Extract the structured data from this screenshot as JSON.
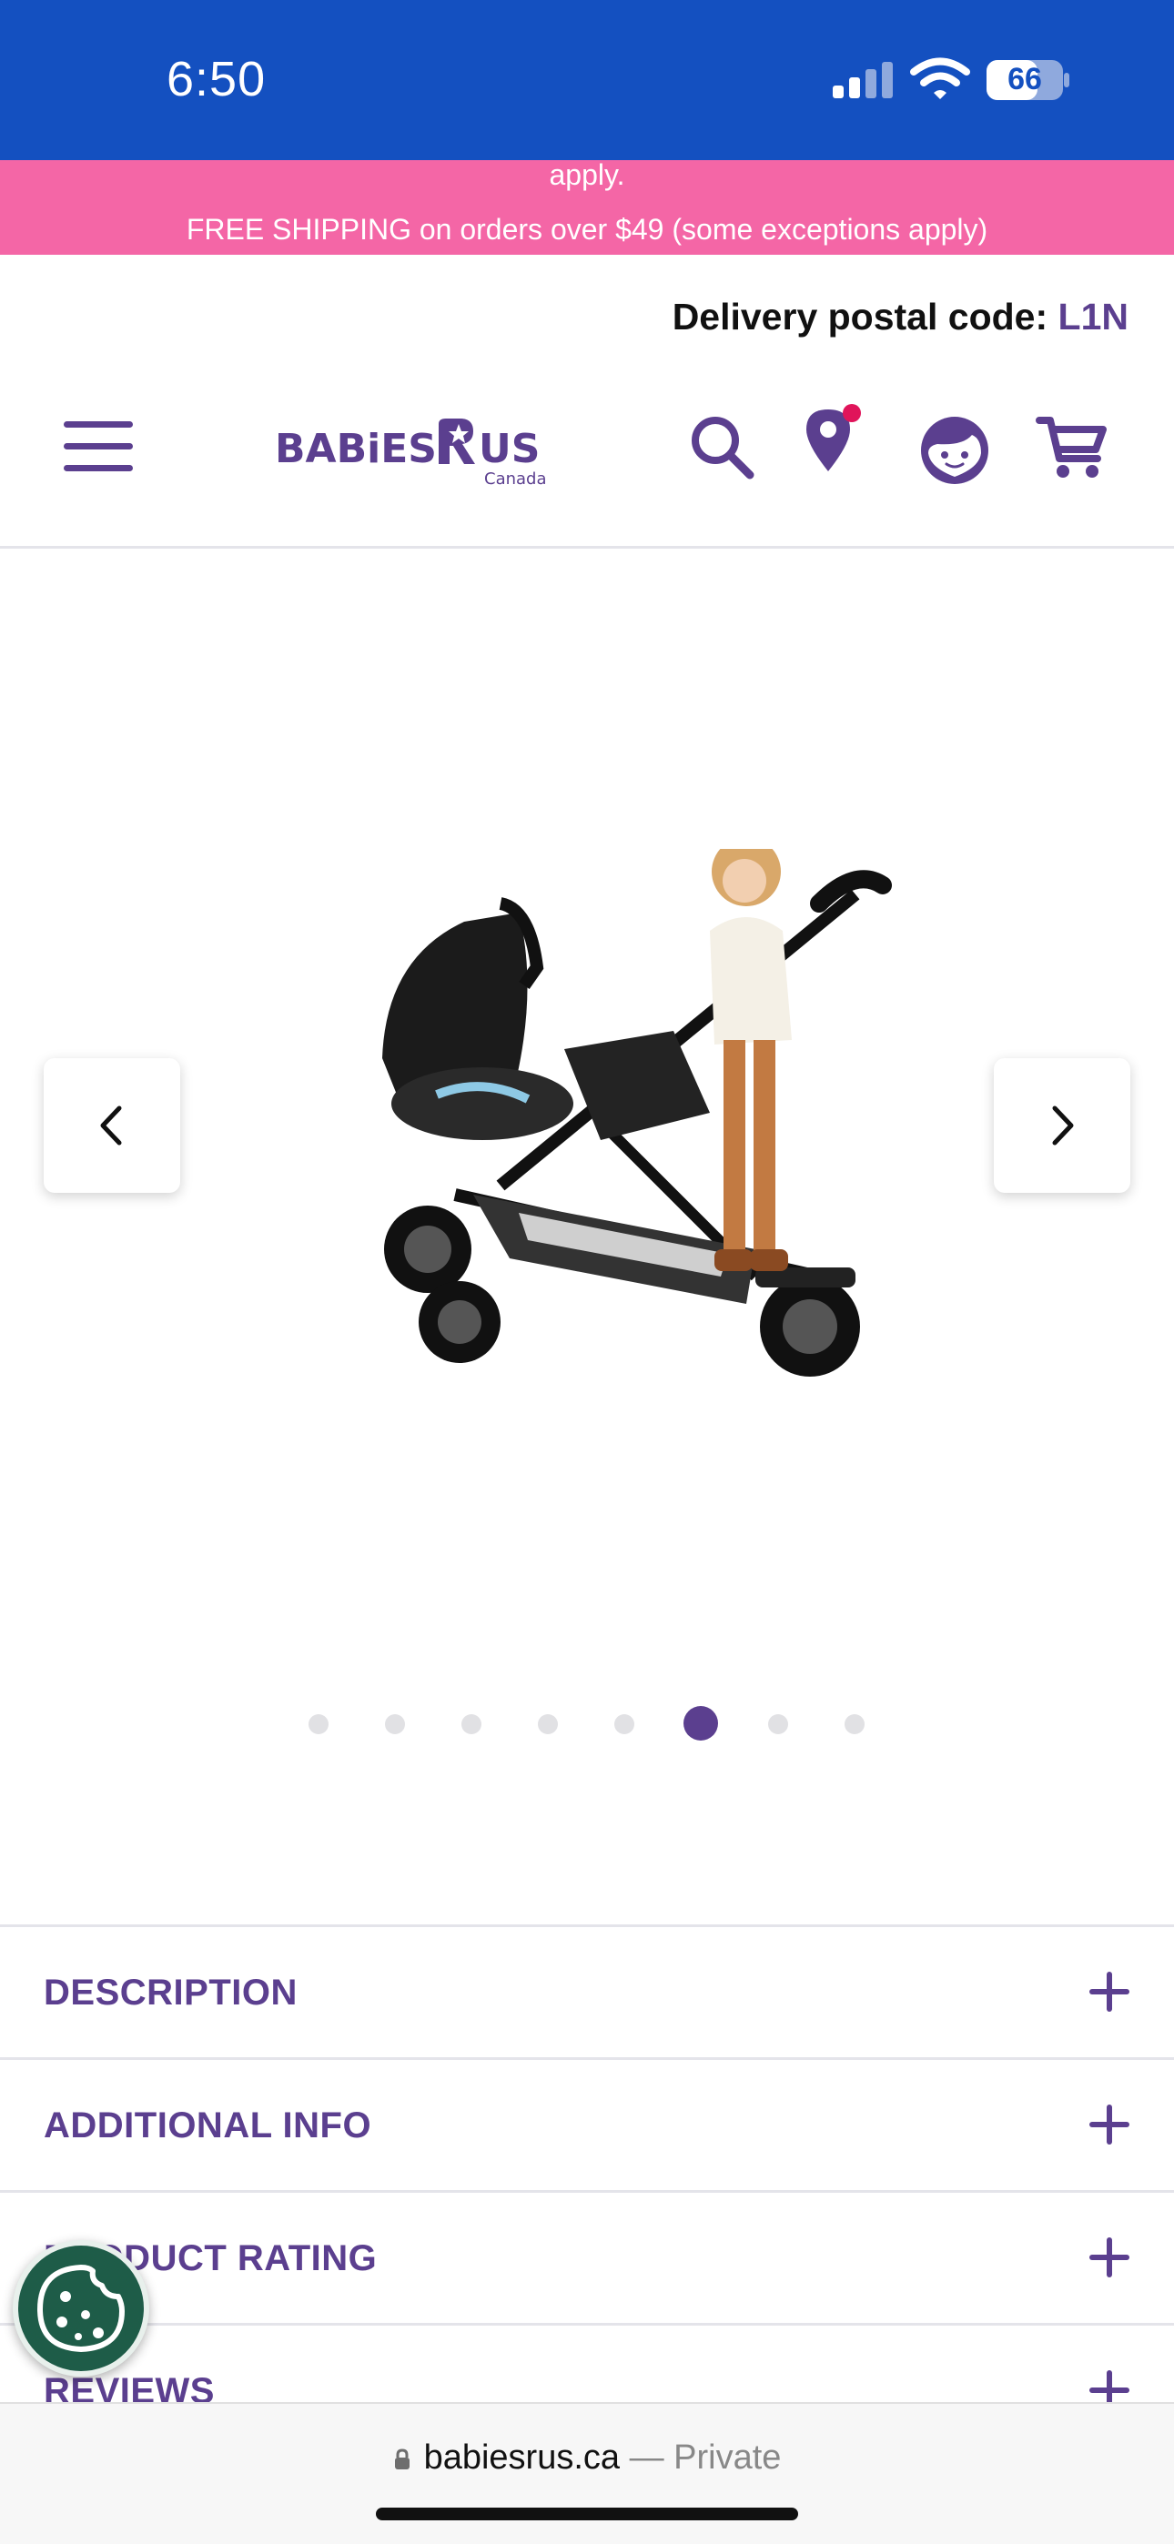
{
  "status_bar": {
    "time": "6:50",
    "battery": "66"
  },
  "promo": {
    "previous_text": "apply.",
    "text": "FREE SHIPPING on orders over $49 (some exceptions apply)"
  },
  "header": {
    "postal_label": "Delivery postal code:",
    "postal_code": "L1N",
    "logo_text": "BABIES R US",
    "logo_sub": "Canada",
    "icons": [
      "menu-icon",
      "search-icon",
      "store-locator-icon",
      "account-icon",
      "cart-icon"
    ]
  },
  "carousel": {
    "slide_count": 8,
    "active_index": 5,
    "image_alt": "Stroller with infant car seat and standing child"
  },
  "accordion": [
    {
      "label": "DESCRIPTION"
    },
    {
      "label": "ADDITIONAL INFO"
    },
    {
      "label": "PRODUCT RATING"
    },
    {
      "label": "REVIEWS"
    }
  ],
  "browser": {
    "host": "babiesrus.ca",
    "separator": " — ",
    "mode": "Private"
  },
  "colors": {
    "status_bar": "#1450c0",
    "promo": "#f466a6",
    "brand_purple": "#5b3f8f",
    "cookie": "#1e5c48"
  }
}
